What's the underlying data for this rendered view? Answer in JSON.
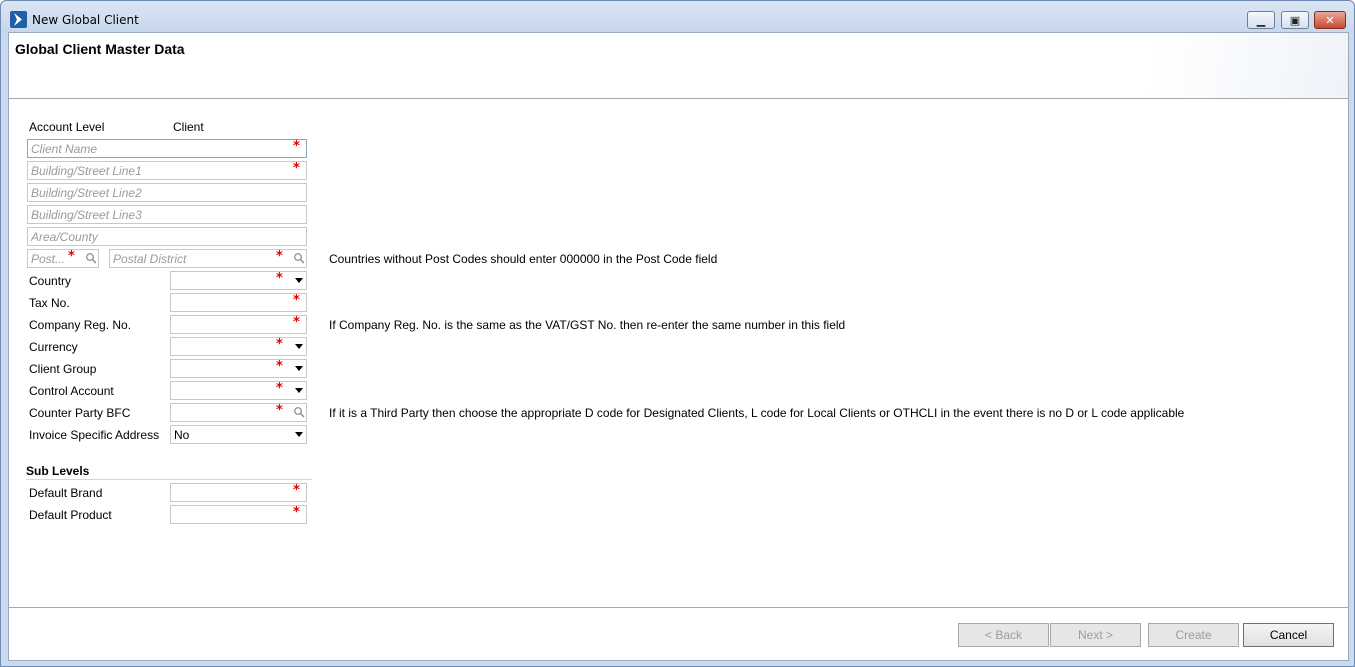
{
  "window": {
    "title": "New Global Client",
    "minimize_label": "▁",
    "maximize_label": "▣",
    "close_label": "✕"
  },
  "page_title": "Global Client Master Data",
  "account_level": {
    "label": "Account Level",
    "value": "Client"
  },
  "address": {
    "client_name_placeholder": "Client Name",
    "street1_placeholder": "Building/Street Line1",
    "street2_placeholder": "Building/Street Line2",
    "street3_placeholder": "Building/Street Line3",
    "area_placeholder": "Area/County",
    "post_placeholder": "Post...",
    "district_placeholder": "Postal District",
    "post_note": "Countries without Post Codes should enter 000000 in the Post Code field"
  },
  "fields": {
    "country": "Country",
    "tax_no": "Tax No.",
    "company_reg": "Company Reg. No.",
    "company_reg_note": "If Company Reg. No. is the same as the VAT/GST No. then re-enter the same number in this field",
    "currency": "Currency",
    "client_group": "Client Group",
    "control_account": "Control Account",
    "counter_party": "Counter Party BFC",
    "counter_party_note": "If it is a Third Party then choose the appropriate D code for Designated Clients, L code for Local Clients or OTHCLI in the event there is no D or L code applicable",
    "invoice_address": "Invoice Specific Address",
    "invoice_address_value": "No"
  },
  "sub_levels": {
    "title": "Sub Levels",
    "default_brand": "Default Brand",
    "default_product": "Default Product"
  },
  "required_marker": "*",
  "buttons": {
    "back": "< Back",
    "next": "Next >",
    "create": "Create",
    "cancel": "Cancel"
  }
}
